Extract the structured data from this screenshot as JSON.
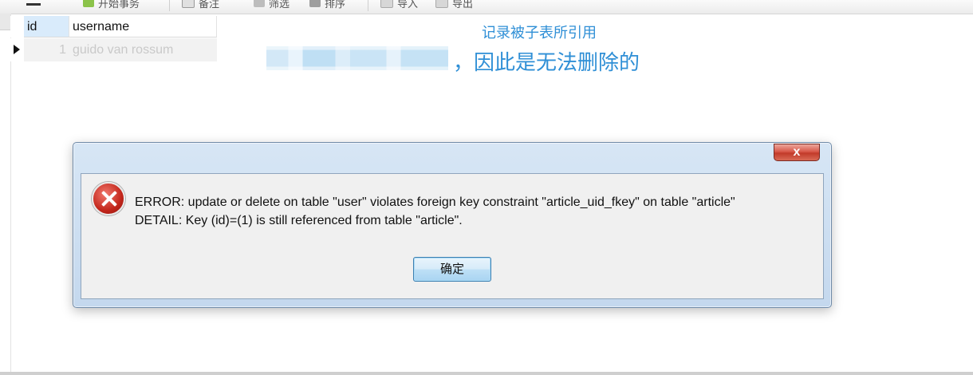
{
  "toolbar": {
    "items": [
      {
        "label": "开始事务",
        "icon": "transaction-icon"
      },
      {
        "label": "备注",
        "icon": "memo-icon"
      },
      {
        "label": "筛选",
        "icon": "filter-icon"
      },
      {
        "label": "排序",
        "icon": "sort-icon"
      },
      {
        "label": "导入",
        "icon": "import-icon"
      },
      {
        "label": "导出",
        "icon": "export-icon"
      }
    ]
  },
  "grid": {
    "columns": [
      "id",
      "username"
    ],
    "rows": [
      {
        "id": "1",
        "username": "guido van rossum"
      }
    ]
  },
  "annotations": {
    "line1": "记录被子表所引用",
    "line2": "，因此是无法删除的"
  },
  "dialog": {
    "close_label": "x",
    "error_line": "ERROR:  update or delete on table \"user\" violates foreign key constraint \"article_uid_fkey\" on table \"article\"",
    "detail_line": "DETAIL:  Key (id)=(1) is still referenced from table \"article\".",
    "ok_label": "确定"
  },
  "colors": {
    "annotation": "#2f8fd6",
    "selected_header": "#d9ebfb",
    "close_button": "#c23a2a"
  }
}
